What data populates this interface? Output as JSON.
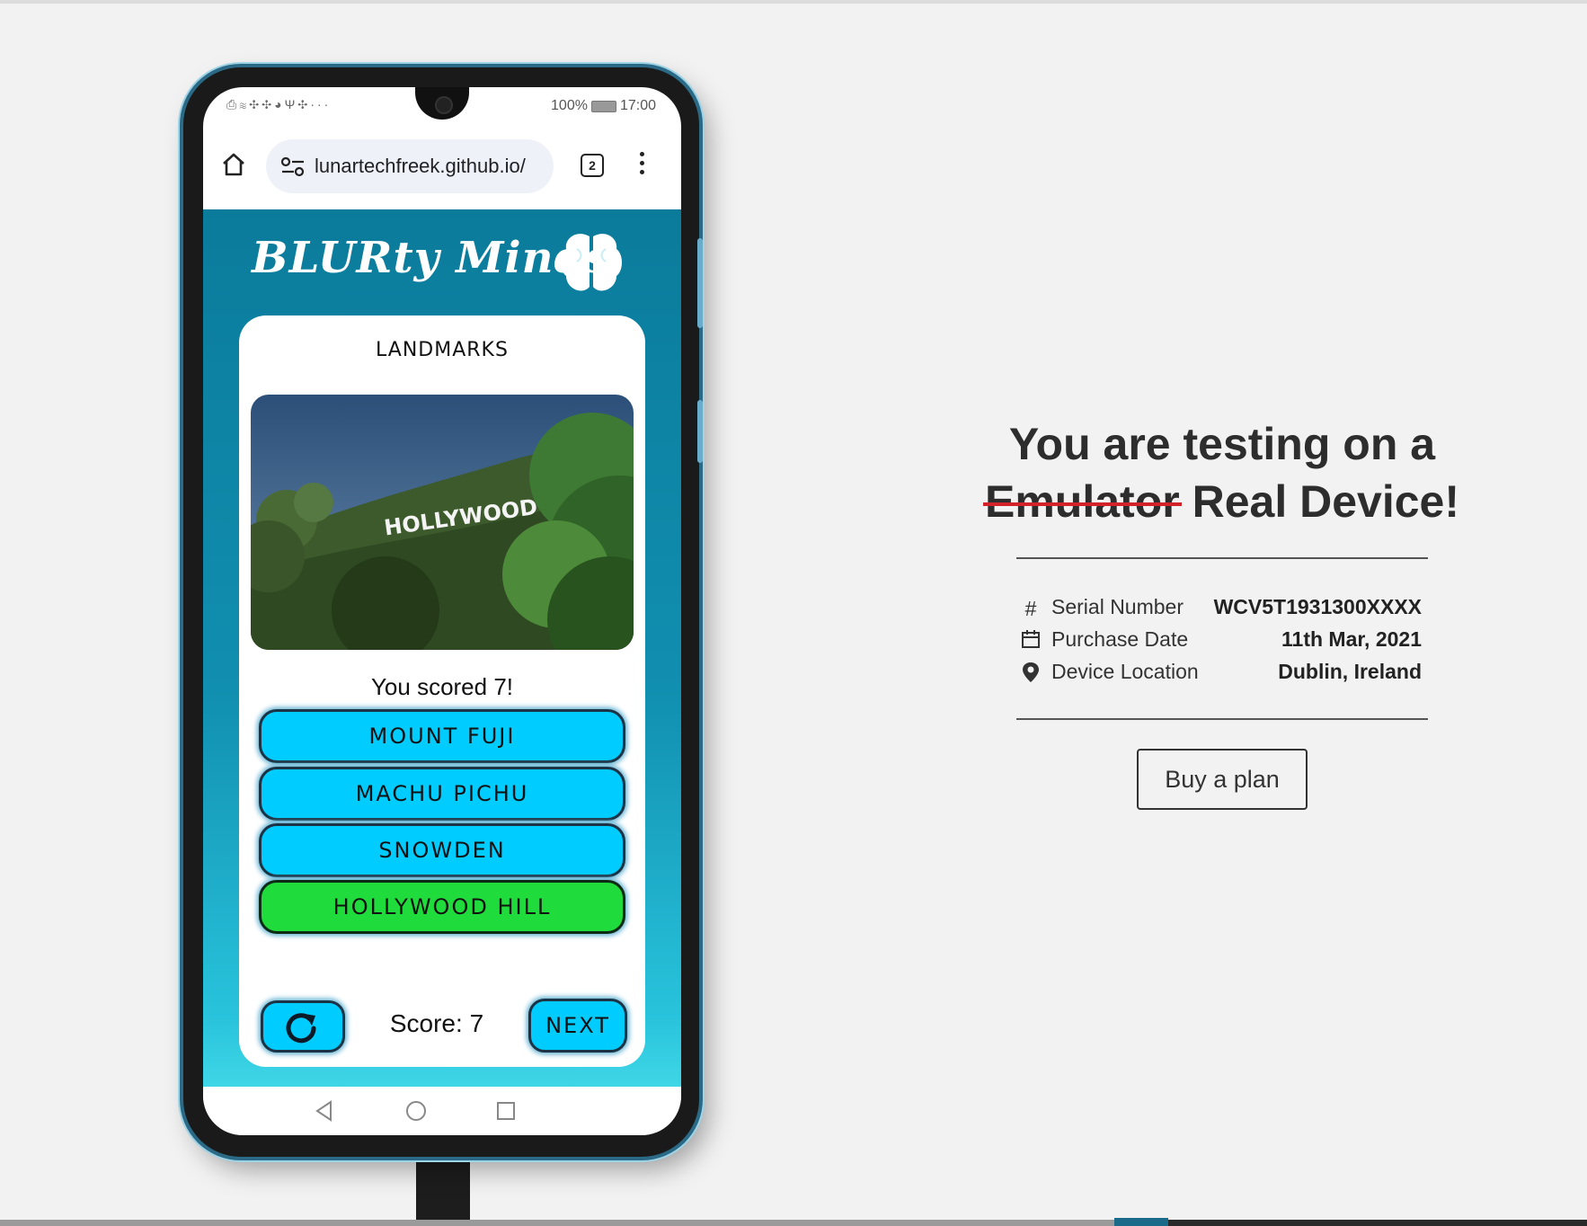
{
  "device": {
    "status_left_icons": "⎙≋✣✣◕Ψ✣···",
    "battery": "100%",
    "time": "17:00",
    "url": "lunartechfreek.github.io/",
    "tab_count": "2"
  },
  "app": {
    "title": "BLURty Minds",
    "category": "LANDMARKS",
    "image_text": "HOLLYWOOD",
    "result": "You scored 7!",
    "answers": [
      {
        "label": "MOUNT FUJI",
        "state": "default"
      },
      {
        "label": "MACHU PICHU",
        "state": "default"
      },
      {
        "label": "SNOWDEN",
        "state": "default"
      },
      {
        "label": "HOLLYWOOD HILL",
        "state": "correct"
      }
    ],
    "score": "Score: 7",
    "next": "NEXT",
    "colors": {
      "answer": "#00ccff",
      "correct": "#1fdc3c",
      "app_top": "#0b7b9b"
    }
  },
  "panel": {
    "headline_line1": "You are testing on a",
    "struck": "Emulator",
    "headline_rest": "Real Device!",
    "rows": [
      {
        "icon": "hash-icon",
        "label": "Serial Number",
        "value": "WCV5T1931300XXXX"
      },
      {
        "icon": "calendar-icon",
        "label": "Purchase Date",
        "value": "11th Mar, 2021"
      },
      {
        "icon": "location-pin-icon",
        "label": "Device Location",
        "value": "Dublin, Ireland"
      }
    ],
    "buy_label": "Buy a plan",
    "strike_color": "#d2232a"
  }
}
